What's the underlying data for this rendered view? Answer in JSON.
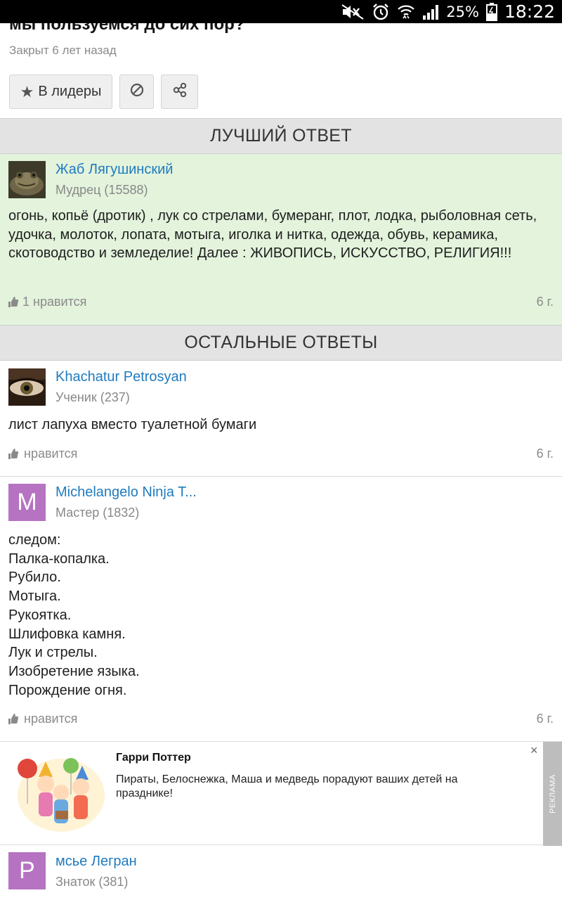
{
  "status_bar": {
    "battery_pct": "25%",
    "time": "18:22",
    "icons": [
      "mute-icon",
      "alarm-icon",
      "wifi-icon",
      "signal-icon",
      "battery-charging-icon"
    ]
  },
  "question": {
    "title_partial": "мы пользуемся до сих пор?",
    "closed_text": "Закрыт 6 лет назад",
    "leaders_label": "В лидеры"
  },
  "sections": {
    "best": "ЛУЧШИЙ ОТВЕТ",
    "others": "ОСТАЛЬНЫЕ ОТВЕТЫ"
  },
  "best_answer": {
    "author": "Жаб Лягушинский",
    "rank": "Мудрец (15588)",
    "text": "огонь, копьё (дротик) , лук со стрелами, бумеранг, плот, лодка, рыболовная сеть, удочка, молоток, лопата, мотыга, иголка и нитка, одежда, обувь, керамика, скотоводство и земледелие! Далее : ЖИВОПИСЬ, ИСКУССТВО, РЕЛИГИЯ!!!",
    "likes": "1 нравится",
    "age": "6 г."
  },
  "answers": [
    {
      "author": "Khachatur Petrosyan",
      "rank": "Ученик (237)",
      "text": "лист лапуха вместо туалетной бумаги",
      "likes": "нравится",
      "age": "6 г."
    },
    {
      "author": "Michelangelo Ninja T...",
      "avatar_letter": "M",
      "avatar_color": "#b673c2",
      "rank": "Мастер (1832)",
      "lines": [
        "следом:",
        "Палка-копалка.",
        "Рубило.",
        "Мотыга.",
        "Рукоятка.",
        "Шлифовка камня.",
        "Лук и стрелы.",
        "Изобретение языка.",
        "Порождение огня."
      ],
      "likes": "нравится",
      "age": "6 г."
    },
    {
      "author": "мсье Легран",
      "avatar_letter": "P",
      "avatar_color": "#b673c2",
      "rank": "Знаток (381)"
    }
  ],
  "ad": {
    "title": "Гарри Поттер",
    "text": "Пираты, Белоснежка, Маша и медведь порадуют ваших детей на празднике!",
    "label": "РЕКЛАМА",
    "close": "×"
  },
  "colors": {
    "link": "#1f7bbf",
    "best_bg": "#e3f3dc",
    "section_bg": "#e3e3e3",
    "avatar_purple": "#b673c2"
  }
}
